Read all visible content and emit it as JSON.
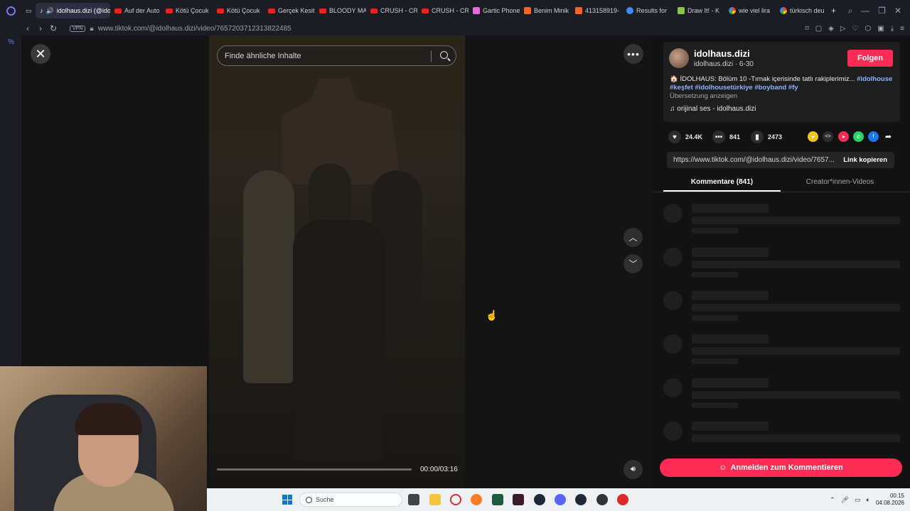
{
  "browser": {
    "tabs": [
      {
        "label": "idolhaus.dizi (@idolhaus.dizi)",
        "active": true,
        "icon": "tiktok-icon"
      },
      {
        "label": "Auf der Auto",
        "icon": "youtube-icon"
      },
      {
        "label": "Kötü Çocuk",
        "icon": "youtube-icon"
      },
      {
        "label": "Kötü Çocuk",
        "icon": "youtube-icon"
      },
      {
        "label": "Gerçek Kesit",
        "icon": "youtube-icon"
      },
      {
        "label": "BLOODY MARY",
        "icon": "youtube-icon"
      },
      {
        "label": "CRUSH - CR",
        "icon": "youtube-icon"
      },
      {
        "label": "CRUSH - CR",
        "icon": "youtube-icon"
      },
      {
        "label": "Gartic Phone",
        "icon": "gartic-icon"
      },
      {
        "label": "Benim Minik",
        "icon": "w-icon"
      },
      {
        "label": "413158919-",
        "icon": "w-icon"
      },
      {
        "label": "Results for",
        "icon": "results-icon"
      },
      {
        "label": "Draw It! - K",
        "icon": "draw-icon"
      },
      {
        "label": "wie viel lira",
        "icon": "google-icon"
      },
      {
        "label": "türkisch deu",
        "icon": "google-icon"
      }
    ],
    "new_tab": "+",
    "vpn_label": "VPN",
    "url": "www.tiktok.com/@idolhaus.dizi/video/7657203712313822485"
  },
  "video": {
    "search_placeholder": "Finde ähnliche Inhalte",
    "time": "00:00/03:16",
    "progress": 0
  },
  "author": {
    "name": "idolhaus.dizi",
    "sub": "idolhaus.dizi · 6-30",
    "follow_label": "Folgen",
    "description_text": "🏠 İDOLHAUS: Bölüm 10 -Tırnak içerisinde tatlı rakiplerimiz...",
    "hashtags": [
      "#idolhouse",
      "#keşfet",
      "#idolhousetürkiye",
      "#boyband",
      "#fy"
    ],
    "translate_label": "Übersetzung anzeigen",
    "music": "orijinal ses - idolhaus.dizi"
  },
  "stats": {
    "likes": "24.4K",
    "comments": "841",
    "saves": "2473"
  },
  "link": {
    "url": "https://www.tiktok.com/@idolhaus.dizi/video/7657...",
    "copy_label": "Link kopieren"
  },
  "panel_tabs": {
    "comments": "Kommentare (841)",
    "creator": "Creator*innen-Videos"
  },
  "comment_button": "Anmelden zum Kommentieren",
  "taskbar": {
    "search_label": "Suche",
    "time": "00:15",
    "date": "04.08.2026"
  },
  "colors": {
    "accent": "#fe2c55",
    "hashtag": "#8cb4ff"
  }
}
